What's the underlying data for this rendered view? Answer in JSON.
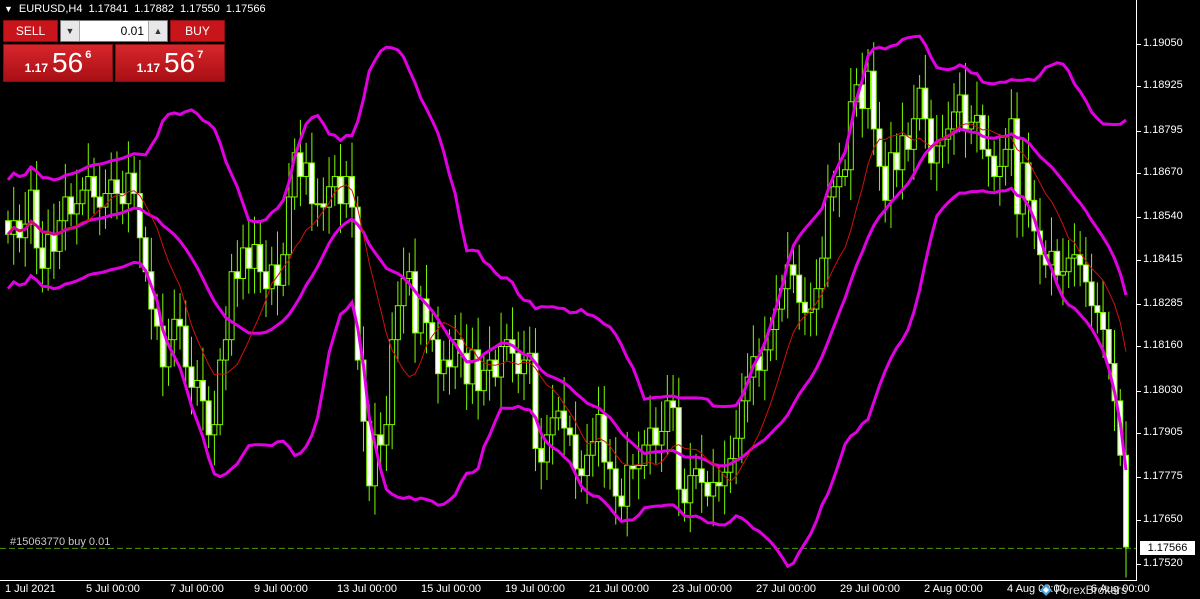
{
  "title_bar": {
    "symbol": "EURUSD,H4",
    "open": "1.17841",
    "high": "1.17882",
    "low": "1.17550",
    "close": "1.17566"
  },
  "trade_panel": {
    "sell_label": "SELL",
    "buy_label": "BUY",
    "lot_value": "0.01",
    "sell_price": {
      "prefix": "1.17",
      "main": "56",
      "sup": "6"
    },
    "buy_price": {
      "prefix": "1.17",
      "main": "56",
      "sup": "7"
    }
  },
  "order_line_label": "#15063770 buy 0.01",
  "current_price_tag": "1.17566",
  "watermark": "ForexBrokers",
  "colors": {
    "background": "#000000",
    "candle": "#7cfc00",
    "candle_body_up": "#000000",
    "candle_body_down": "#ffffff",
    "bollinger": "#e100e1",
    "ma": "#d01010",
    "sell_buy": "#c8151b"
  },
  "chart_data": {
    "type": "candlestick",
    "symbol": "EURUSD",
    "timeframe": "H4",
    "y_ticks": [
      "1.19050",
      "1.18925",
      "1.18795",
      "1.18670",
      "1.18540",
      "1.18415",
      "1.18285",
      "1.18160",
      "1.18030",
      "1.17905",
      "1.17775",
      "1.17650",
      "1.17520"
    ],
    "ylim": [
      1.1747,
      1.1927
    ],
    "x_ticks": [
      "1 Jul 2021",
      "5 Jul 00:00",
      "7 Jul 00:00",
      "9 Jul 00:00",
      "13 Jul 00:00",
      "15 Jul 00:00",
      "19 Jul 00:00",
      "21 Jul 00:00",
      "23 Jul 00:00",
      "27 Jul 00:00",
      "29 Jul 00:00",
      "2 Aug 00:00",
      "4 Aug 00:00",
      "6 Aug 00:00"
    ],
    "indicators": [
      "Bollinger Bands",
      "Moving Average"
    ],
    "closes": [
      1.1849,
      1.1853,
      1.1848,
      1.1852,
      1.1862,
      1.1845,
      1.1839,
      1.1849,
      1.1844,
      1.1853,
      1.186,
      1.1855,
      1.1858,
      1.1862,
      1.1866,
      1.186,
      1.1857,
      1.1861,
      1.1865,
      1.1861,
      1.1858,
      1.1867,
      1.1861,
      1.1848,
      1.1838,
      1.1827,
      1.1822,
      1.181,
      1.1818,
      1.1824,
      1.1822,
      1.181,
      1.1804,
      1.1806,
      1.18,
      1.179,
      1.1793,
      1.1812,
      1.1818,
      1.1838,
      1.1836,
      1.1845,
      1.1839,
      1.1846,
      1.1838,
      1.1833,
      1.184,
      1.1834,
      1.1843,
      1.186,
      1.1873,
      1.1866,
      1.187,
      1.1858,
      1.1858,
      1.1857,
      1.1863,
      1.1866,
      1.1858,
      1.1866,
      1.1857,
      1.1812,
      1.1794,
      1.1775,
      1.179,
      1.1787,
      1.1793,
      1.1818,
      1.1828,
      1.1836,
      1.1838,
      1.182,
      1.183,
      1.1823,
      1.1818,
      1.1808,
      1.1812,
      1.181,
      1.1818,
      1.1814,
      1.1805,
      1.1815,
      1.1803,
      1.1809,
      1.1812,
      1.1807,
      1.1816,
      1.1818,
      1.1814,
      1.1808,
      1.1812,
      1.1814,
      1.1786,
      1.1782,
      1.179,
      1.1795,
      1.1797,
      1.1792,
      1.179,
      1.178,
      1.1778,
      1.1784,
      1.1788,
      1.1796,
      1.1782,
      1.178,
      1.1772,
      1.1769,
      1.1781,
      1.178,
      1.1781,
      1.1787,
      1.1792,
      1.1787,
      1.1791,
      1.18,
      1.1798,
      1.1774,
      1.177,
      1.1778,
      1.178,
      1.1776,
      1.1772,
      1.1776,
      1.1775,
      1.1779,
      1.1783,
      1.1789,
      1.18,
      1.1807,
      1.1813,
      1.1809,
      1.1815,
      1.1821,
      1.1827,
      1.1833,
      1.184,
      1.1837,
      1.1829,
      1.1826,
      1.1827,
      1.1833,
      1.1842,
      1.186,
      1.1863,
      1.1866,
      1.1868,
      1.1888,
      1.1893,
      1.1886,
      1.1897,
      1.188,
      1.1869,
      1.1859,
      1.1873,
      1.1868,
      1.1878,
      1.1874,
      1.1883,
      1.1892,
      1.1883,
      1.187,
      1.1875,
      1.1877,
      1.188,
      1.1885,
      1.189,
      1.188,
      1.1882,
      1.1884,
      1.1874,
      1.1872,
      1.1866,
      1.1869,
      1.1874,
      1.1883,
      1.1855,
      1.187,
      1.1859,
      1.185,
      1.1843,
      1.184,
      1.1844,
      1.1837,
      1.1838,
      1.1842,
      1.1843,
      1.184,
      1.1835,
      1.1828,
      1.1826,
      1.1821,
      1.1811,
      1.18,
      1.1784,
      1.1757
    ]
  }
}
